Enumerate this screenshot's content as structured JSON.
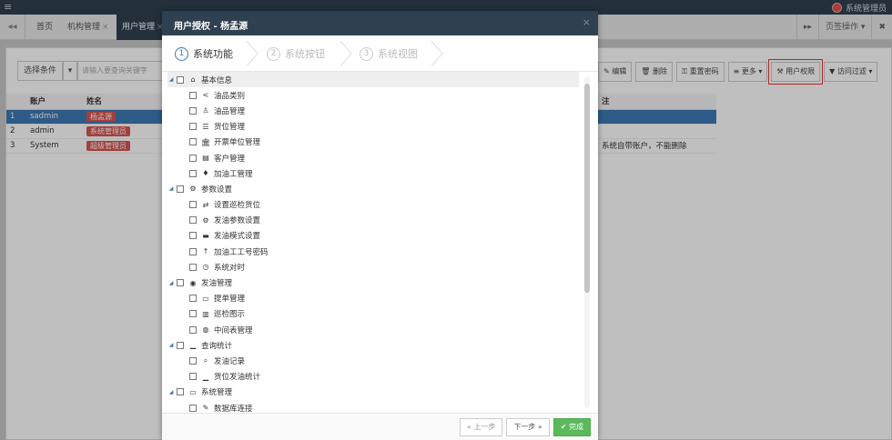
{
  "app": {
    "username": "系统管理员"
  },
  "tabs": {
    "home": "首页",
    "org": "机构管理",
    "user": "用户管理",
    "close": "×",
    "page_ops": "页签操作",
    "nav_left": "◂◂",
    "nav_right": "▸▸",
    "close_all": "✖"
  },
  "toolbar": {
    "select_condition": "选择条件",
    "search_placeholder": "请输入要查询关键字",
    "edit": "编辑",
    "delete": "删除",
    "reset_password": "重置密码",
    "more": "更多",
    "user_permission": "用户权限",
    "access_filter": "访问过滤"
  },
  "grid": {
    "columns": [
      "账户",
      "姓名"
    ],
    "rows": [
      {
        "num": "1",
        "account": "sadmin",
        "name": "杨孟源",
        "note": ""
      },
      {
        "num": "2",
        "account": "admin",
        "name": "系统管理员",
        "note": ""
      },
      {
        "num": "3",
        "account": "System",
        "name": "超级管理员",
        "note": "系统自带账户，不能删除"
      }
    ],
    "remark_header": "注"
  },
  "modal": {
    "title": "用户授权 - 杨孟源",
    "close": "×",
    "steps": [
      {
        "num": "1",
        "label": "系统功能"
      },
      {
        "num": "2",
        "label": "系统按钮"
      },
      {
        "num": "3",
        "label": "系统视图"
      }
    ],
    "tree": [
      {
        "level": 0,
        "icon": "⌂",
        "icon_name": "home-icon",
        "label": "基本信息"
      },
      {
        "level": 1,
        "icon": "<",
        "icon_name": "share-icon",
        "label": "油品类别"
      },
      {
        "level": 1,
        "icon": "♙",
        "icon_name": "flask-icon",
        "label": "油品管理"
      },
      {
        "level": 1,
        "icon": "☰",
        "icon_name": "list-icon",
        "label": "货位管理"
      },
      {
        "level": 1,
        "icon": "🏛",
        "icon_name": "bank-icon",
        "label": "开票单位管理"
      },
      {
        "level": 1,
        "icon": "▤",
        "icon_name": "building-icon",
        "label": "客户管理"
      },
      {
        "level": 1,
        "icon": "♦",
        "icon_name": "pump-icon",
        "label": "加油工管理"
      },
      {
        "level": 0,
        "icon": "⚙",
        "icon_name": "cogs-icon",
        "label": "参数设置"
      },
      {
        "level": 1,
        "icon": "⇄",
        "icon_name": "exchange-icon",
        "label": "设置巡检货位"
      },
      {
        "level": 1,
        "icon": "⚙",
        "icon_name": "gear-icon",
        "label": "发油参数设置"
      },
      {
        "level": 1,
        "icon": "▬",
        "icon_name": "display-icon",
        "label": "发油模式设置"
      },
      {
        "level": 1,
        "icon": "↑",
        "icon_name": "arrow-up-icon",
        "label": "加油工工号密码"
      },
      {
        "level": 1,
        "icon": "◷",
        "icon_name": "clock-icon",
        "label": "系统对时"
      },
      {
        "level": 0,
        "icon": "◉",
        "icon_name": "target-icon",
        "label": "发油管理"
      },
      {
        "level": 1,
        "icon": "▭",
        "icon_name": "bill-icon",
        "label": "提单管理"
      },
      {
        "level": 1,
        "icon": "▥",
        "icon_name": "monitor-icon",
        "label": "巡检图示"
      },
      {
        "level": 1,
        "icon": "◍",
        "icon_name": "globe-icon",
        "label": "中间表管理"
      },
      {
        "level": 0,
        "icon": "▁",
        "icon_name": "area-chart-icon",
        "label": "查询统计"
      },
      {
        "level": 1,
        "icon": "⌕",
        "icon_name": "search-icon",
        "label": "发油记录"
      },
      {
        "level": 1,
        "icon": "▁",
        "icon_name": "bar-chart-icon",
        "label": "货位发油统计"
      },
      {
        "level": 0,
        "icon": "▭",
        "icon_name": "desktop-icon",
        "label": "系统管理"
      },
      {
        "level": 1,
        "icon": "✎",
        "icon_name": "db-link-icon",
        "label": "数据库连接"
      }
    ],
    "footer": {
      "prev": "« 上一步",
      "next": "下一步 »",
      "finish": "完成"
    }
  }
}
